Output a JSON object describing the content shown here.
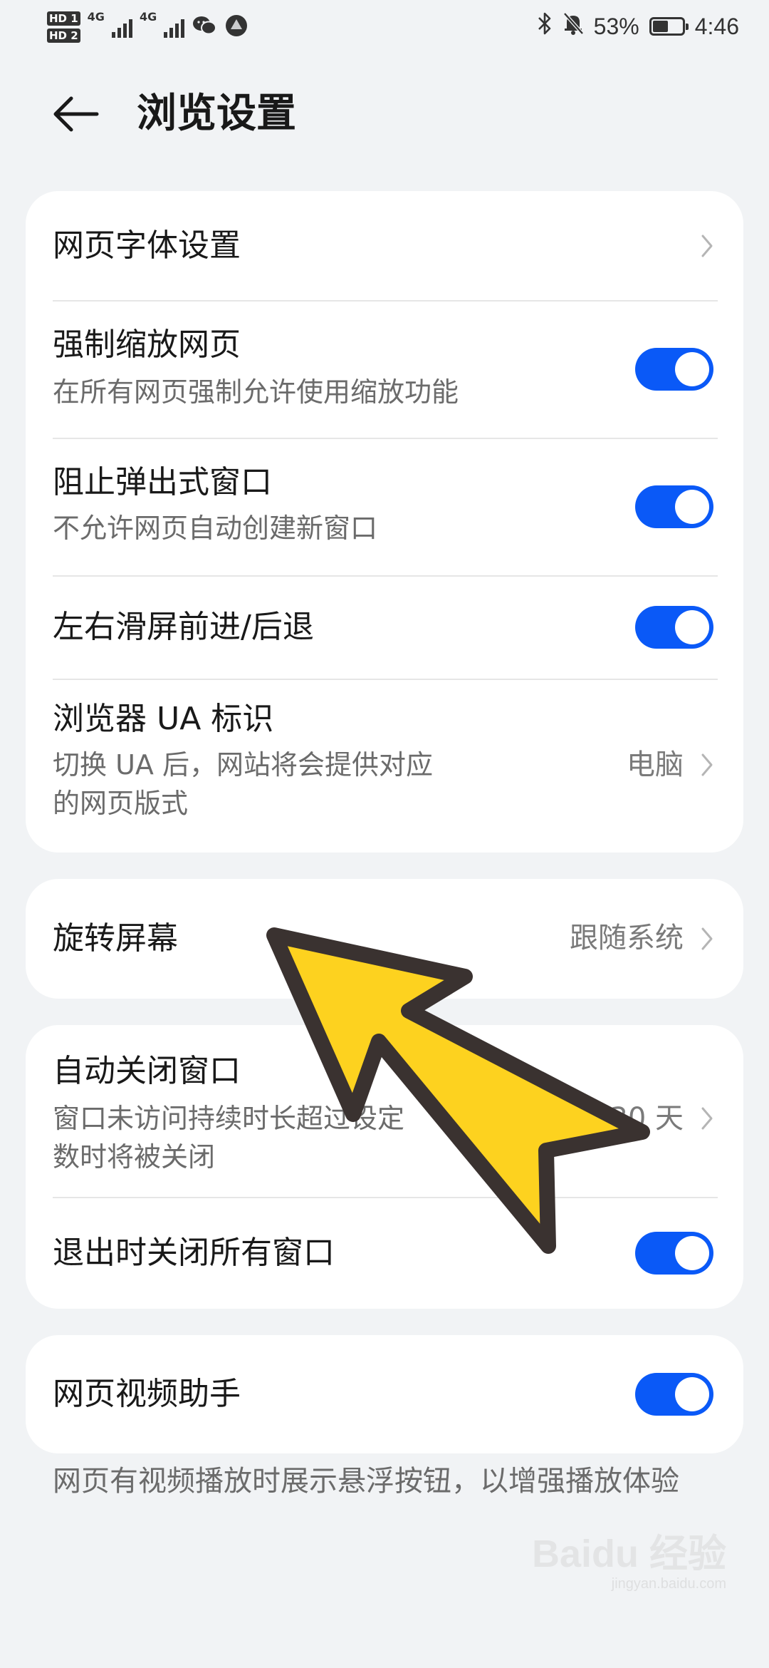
{
  "status_bar": {
    "hd1": "HD 1",
    "hd2": "HD 2",
    "net1": "4G",
    "net2": "4G",
    "battery_percent": "53%",
    "battery_level": 0.53,
    "time": "4:46",
    "icons": [
      "signal-icon",
      "wechat-icon",
      "browser-icon",
      "bluetooth-icon",
      "mute-bell-icon",
      "battery-icon"
    ]
  },
  "header": {
    "title": "浏览设置"
  },
  "colors": {
    "accent": "#0a59f7",
    "background": "#f1f3f5",
    "card": "#ffffff",
    "arrow_fill": "#fdd21f",
    "arrow_stroke": "#3a3230"
  },
  "card1": {
    "font_settings": {
      "title": "网页字体设置"
    },
    "force_zoom": {
      "title": "强制缩放网页",
      "subtitle": "在所有网页强制允许使用缩放功能",
      "on": true
    },
    "block_popups": {
      "title": "阻止弹出式窗口",
      "subtitle": "不允许网页自动创建新窗口",
      "on": true
    },
    "swipe_nav": {
      "title": "左右滑屏前进/后退",
      "on": true
    },
    "ua": {
      "title": "浏览器 UA 标识",
      "subtitle_line1": "切换 UA 后，网站将会提供对应",
      "subtitle_line2": "的网页版式",
      "value": "电脑"
    }
  },
  "card2": {
    "rotate": {
      "title": "旋转屏幕",
      "value": "跟随系统"
    }
  },
  "card3": {
    "auto_close": {
      "title": "自动关闭窗口",
      "subtitle_line1": "窗口未访问持续时长超过设定",
      "subtitle_line2": "数时将被关闭",
      "value": "30 天"
    },
    "close_on_exit": {
      "title": "退出时关闭所有窗口",
      "on": true
    }
  },
  "card4": {
    "video_helper": {
      "title": "网页视频助手",
      "on": true
    }
  },
  "footnote": "网页有视频播放时展示悬浮按钮，以增强播放体验",
  "watermark": {
    "top": "Baidu 经验",
    "bottom": "jingyan.baidu.com"
  }
}
